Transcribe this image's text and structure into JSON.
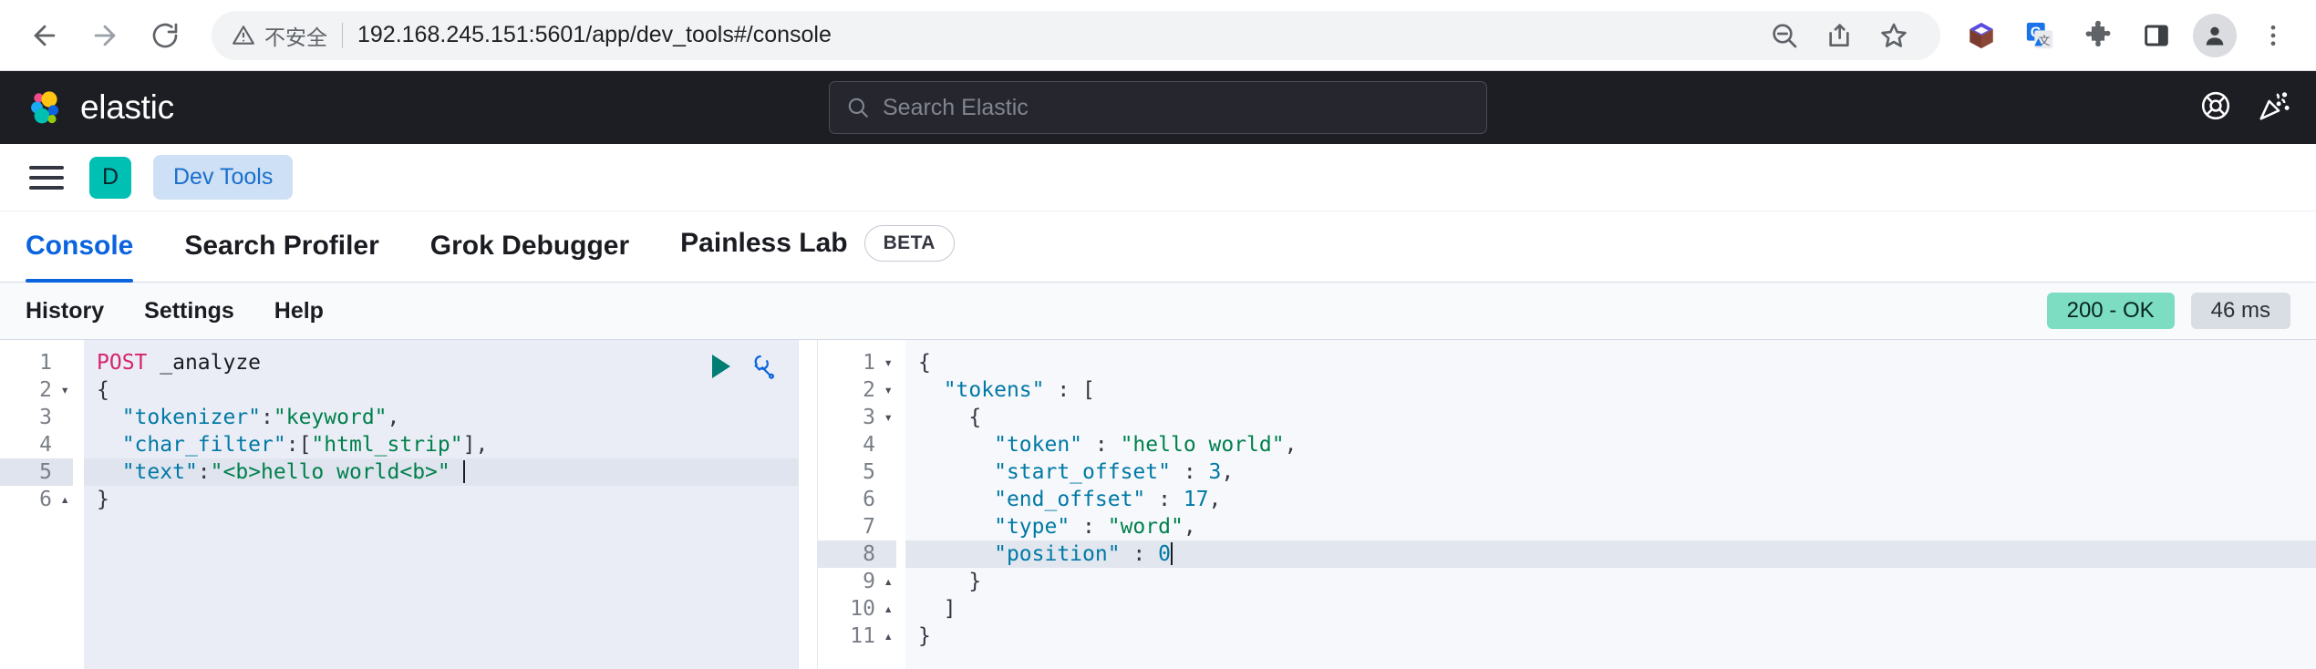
{
  "browser": {
    "back_icon": "back-arrow-icon",
    "forward_icon": "forward-arrow-icon",
    "reload_icon": "reload-icon",
    "security_label": "不安全",
    "url": "192.168.245.151:5601/app/dev_tools#/console",
    "omnibox_actions": [
      "zoom-out-icon",
      "share-icon",
      "bookmark-star-icon"
    ],
    "extensions": [
      "cube-extension-icon",
      "google-translate-icon",
      "puzzle-extensions-icon",
      "side-panel-icon"
    ],
    "profile_icon": "profile-avatar-icon",
    "menu_icon": "three-dot-menu-icon"
  },
  "header": {
    "brand": "elastic",
    "brand_logo": "elastic-cluster-logo",
    "search_placeholder": "Search Elastic",
    "search_icon": "search-icon",
    "help_icon": "lifebuoy-help-icon",
    "news_icon": "party-popper-news-icon"
  },
  "breadcrumb": {
    "menu_icon": "hamburger-menu-icon",
    "space_initial": "D",
    "app_name": "Dev Tools"
  },
  "tabs": [
    {
      "label": "Console",
      "active": true
    },
    {
      "label": "Search Profiler",
      "active": false
    },
    {
      "label": "Grok Debugger",
      "active": false
    },
    {
      "label": "Painless Lab",
      "active": false,
      "badge": "BETA"
    }
  ],
  "console_toolbar": {
    "links": [
      "History",
      "Settings",
      "Help"
    ],
    "status_code": "200 - OK",
    "duration": "46 ms",
    "play_icon": "send-request-play-icon",
    "wrench_icon": "wrench-settings-icon"
  },
  "request_editor": {
    "lines": [
      {
        "num": "1",
        "fold": "",
        "highlight": false,
        "tokens": [
          {
            "t": "method",
            "v": "POST"
          },
          {
            "t": "plain",
            "v": " "
          },
          {
            "t": "path",
            "v": "_analyze"
          }
        ]
      },
      {
        "num": "2",
        "fold": "▾",
        "highlight": false,
        "tokens": [
          {
            "t": "punct",
            "v": "{"
          }
        ]
      },
      {
        "num": "3",
        "fold": "",
        "highlight": false,
        "tokens": [
          {
            "t": "plain",
            "v": "  "
          },
          {
            "t": "key",
            "v": "\"tokenizer\""
          },
          {
            "t": "punct",
            "v": ":"
          },
          {
            "t": "str",
            "v": "\"keyword\""
          },
          {
            "t": "punct",
            "v": ","
          }
        ]
      },
      {
        "num": "4",
        "fold": "",
        "highlight": false,
        "tokens": [
          {
            "t": "plain",
            "v": "  "
          },
          {
            "t": "key",
            "v": "\"char_filter\""
          },
          {
            "t": "punct",
            "v": ":["
          },
          {
            "t": "str",
            "v": "\"html_strip\""
          },
          {
            "t": "punct",
            "v": "],"
          }
        ]
      },
      {
        "num": "5",
        "fold": "",
        "highlight": true,
        "tokens": [
          {
            "t": "plain",
            "v": "  "
          },
          {
            "t": "key",
            "v": "\"text\""
          },
          {
            "t": "punct",
            "v": ":"
          },
          {
            "t": "str",
            "v": "\"<b>hello world<b>\""
          },
          {
            "t": "plain",
            "v": " "
          },
          {
            "t": "cursor",
            "v": ""
          }
        ]
      },
      {
        "num": "6",
        "fold": "▴",
        "highlight": false,
        "tokens": [
          {
            "t": "punct",
            "v": "}"
          }
        ]
      }
    ]
  },
  "response_editor": {
    "lines": [
      {
        "num": "1",
        "fold": "▾",
        "highlight": false,
        "tokens": [
          {
            "t": "punct",
            "v": "{"
          }
        ]
      },
      {
        "num": "2",
        "fold": "▾",
        "highlight": false,
        "tokens": [
          {
            "t": "plain",
            "v": "  "
          },
          {
            "t": "key",
            "v": "\"tokens\""
          },
          {
            "t": "punct",
            "v": " : ["
          }
        ]
      },
      {
        "num": "3",
        "fold": "▾",
        "highlight": false,
        "tokens": [
          {
            "t": "plain",
            "v": "    "
          },
          {
            "t": "punct",
            "v": "{"
          }
        ]
      },
      {
        "num": "4",
        "fold": "",
        "highlight": false,
        "tokens": [
          {
            "t": "plain",
            "v": "      "
          },
          {
            "t": "key",
            "v": "\"token\""
          },
          {
            "t": "punct",
            "v": " : "
          },
          {
            "t": "str",
            "v": "\"hello world\""
          },
          {
            "t": "punct",
            "v": ","
          }
        ]
      },
      {
        "num": "5",
        "fold": "",
        "highlight": false,
        "tokens": [
          {
            "t": "plain",
            "v": "      "
          },
          {
            "t": "key",
            "v": "\"start_offset\""
          },
          {
            "t": "punct",
            "v": " : "
          },
          {
            "t": "num",
            "v": "3"
          },
          {
            "t": "punct",
            "v": ","
          }
        ]
      },
      {
        "num": "6",
        "fold": "",
        "highlight": false,
        "tokens": [
          {
            "t": "plain",
            "v": "      "
          },
          {
            "t": "key",
            "v": "\"end_offset\""
          },
          {
            "t": "punct",
            "v": " : "
          },
          {
            "t": "num",
            "v": "17"
          },
          {
            "t": "punct",
            "v": ","
          }
        ]
      },
      {
        "num": "7",
        "fold": "",
        "highlight": false,
        "tokens": [
          {
            "t": "plain",
            "v": "      "
          },
          {
            "t": "key",
            "v": "\"type\""
          },
          {
            "t": "punct",
            "v": " : "
          },
          {
            "t": "str",
            "v": "\"word\""
          },
          {
            "t": "punct",
            "v": ","
          }
        ]
      },
      {
        "num": "8",
        "fold": "",
        "highlight": true,
        "tokens": [
          {
            "t": "plain",
            "v": "      "
          },
          {
            "t": "key",
            "v": "\"position\""
          },
          {
            "t": "punct",
            "v": " : "
          },
          {
            "t": "num",
            "v": "0"
          },
          {
            "t": "cursor",
            "v": ""
          }
        ]
      },
      {
        "num": "9",
        "fold": "▴",
        "highlight": false,
        "tokens": [
          {
            "t": "plain",
            "v": "    "
          },
          {
            "t": "punct",
            "v": "}"
          }
        ]
      },
      {
        "num": "10",
        "fold": "▴",
        "highlight": false,
        "tokens": [
          {
            "t": "plain",
            "v": "  "
          },
          {
            "t": "punct",
            "v": "]"
          }
        ]
      },
      {
        "num": "11",
        "fold": "▴",
        "highlight": false,
        "tokens": [
          {
            "t": "punct",
            "v": "}"
          }
        ]
      }
    ]
  }
}
